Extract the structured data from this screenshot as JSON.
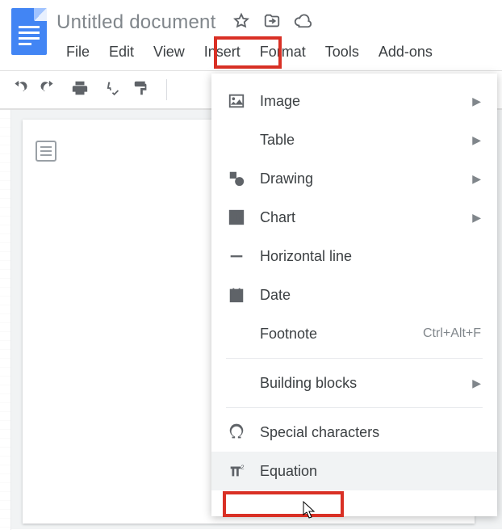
{
  "header": {
    "title": "Untitled document"
  },
  "menubar": {
    "file": "File",
    "edit": "Edit",
    "view": "View",
    "insert": "Insert",
    "format": "Format",
    "tools": "Tools",
    "addons": "Add-ons"
  },
  "insert_menu": {
    "image": "Image",
    "table": "Table",
    "drawing": "Drawing",
    "chart": "Chart",
    "horizontal_line": "Horizontal line",
    "date": "Date",
    "footnote": "Footnote",
    "footnote_shortcut": "Ctrl+Alt+F",
    "building_blocks": "Building blocks",
    "special_characters": "Special characters",
    "equation": "Equation"
  }
}
